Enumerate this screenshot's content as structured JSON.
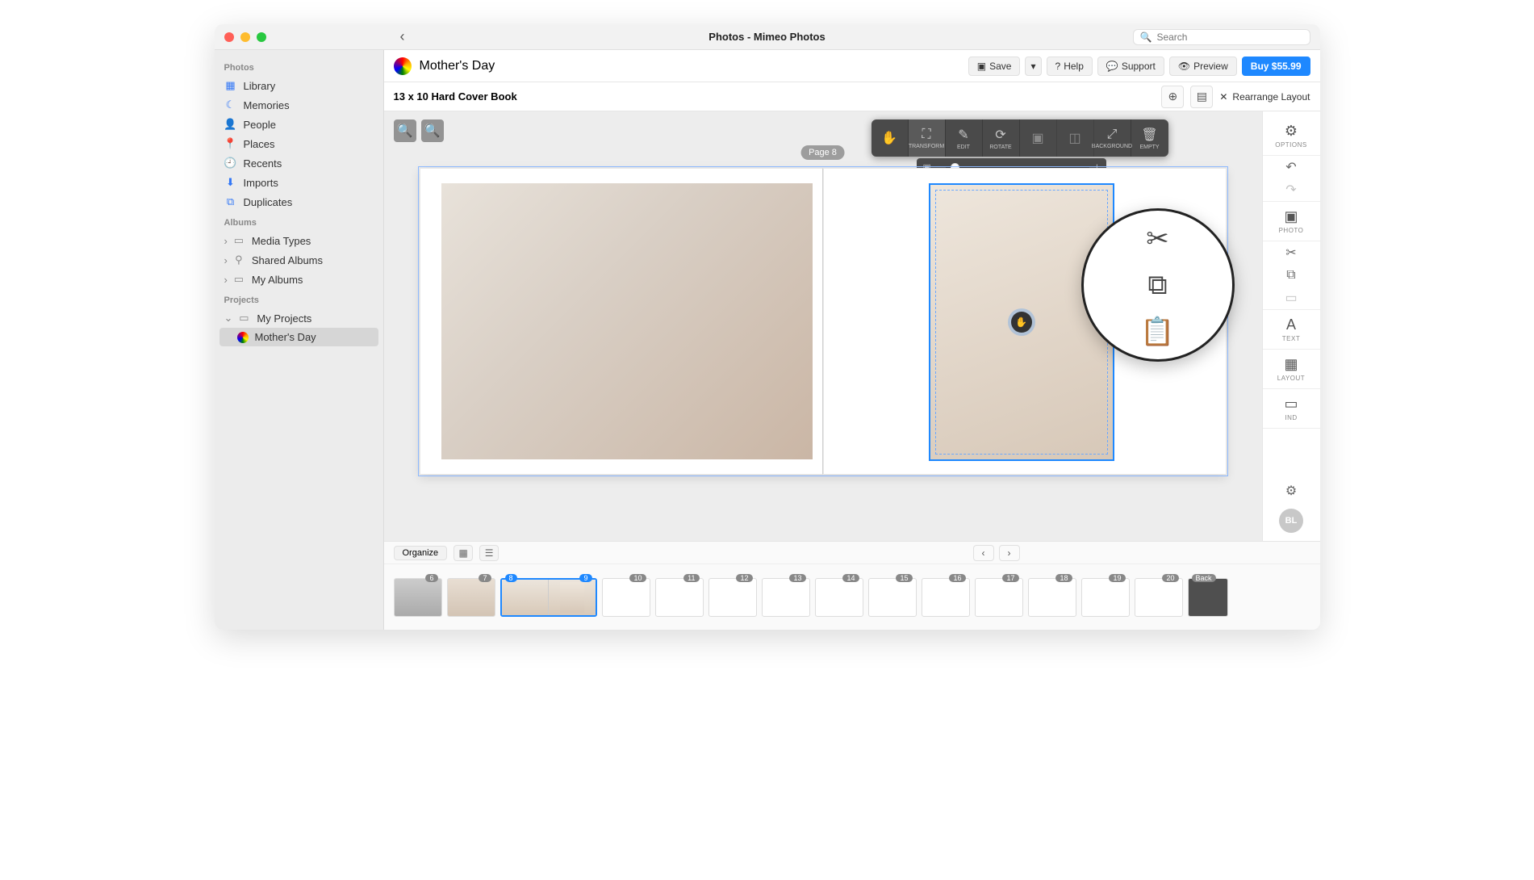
{
  "window": {
    "title": "Photos - Mimeo Photos"
  },
  "search": {
    "placeholder": "Search"
  },
  "sidebar": {
    "sections": {
      "photos": {
        "header": "Photos",
        "items": [
          "Library",
          "Memories",
          "People",
          "Places",
          "Recents",
          "Imports",
          "Duplicates"
        ]
      },
      "albums": {
        "header": "Albums",
        "items": [
          "Media Types",
          "Shared Albums",
          "My Albums"
        ]
      },
      "projects": {
        "header": "Projects",
        "items": [
          "My Projects"
        ],
        "selected": "Mother's Day"
      }
    }
  },
  "topbar": {
    "project_name": "Mother's Day",
    "save": "Save",
    "help": "Help",
    "support": "Support",
    "preview": "Preview",
    "buy": "Buy $55.99"
  },
  "subbar": {
    "description": "13 x 10 Hard Cover Book",
    "rearrange": "Rearrange Layout"
  },
  "canvas": {
    "page_badge": "Page 8"
  },
  "float_toolbar": {
    "items": [
      "",
      "TRANSFORM",
      "EDIT",
      "ROTATE",
      "",
      "",
      "BACKGROUND",
      "EMPTY"
    ]
  },
  "right_panel": {
    "options": "OPTIONS",
    "photo": "PHOTO",
    "text": "TEXT",
    "layout": "LAYOUT",
    "bkgrnd": "IND",
    "avatar": "BL"
  },
  "footer": {
    "organize": "Organize",
    "thumbs": [
      {
        "n": "6",
        "type": "photo1"
      },
      {
        "n": "7",
        "type": "photo2"
      },
      {
        "spread": true,
        "l": "8",
        "r": "9"
      },
      {
        "n": "10"
      },
      {
        "n": "11"
      },
      {
        "n": "12"
      },
      {
        "n": "13"
      },
      {
        "n": "14"
      },
      {
        "n": "15"
      },
      {
        "n": "16"
      },
      {
        "n": "17"
      },
      {
        "n": "18"
      },
      {
        "n": "19"
      },
      {
        "n": "20"
      },
      {
        "n": "Back",
        "type": "back"
      }
    ]
  }
}
